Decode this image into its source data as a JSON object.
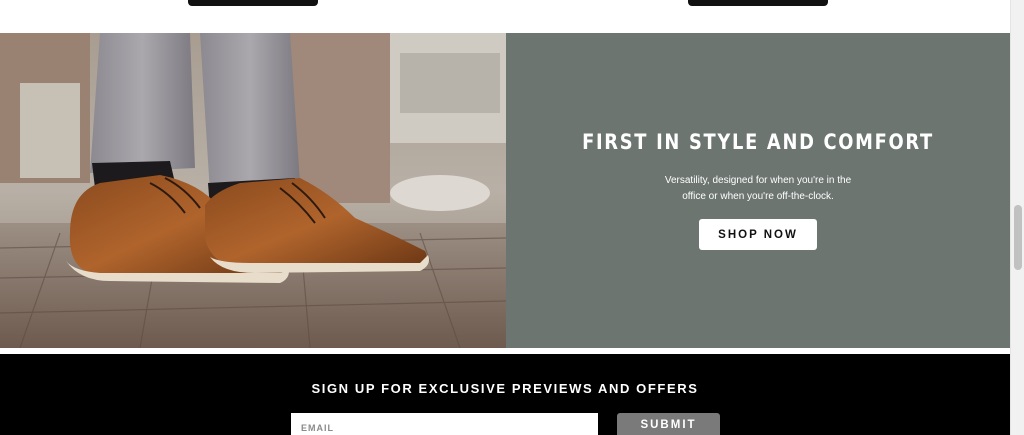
{
  "hero": {
    "title": "FIRST IN STYLE AND COMFORT",
    "description_line1": "Versatility, designed for when you're in the",
    "description_line2": "office or when you're off-the-clock.",
    "cta_label": "SHOP NOW",
    "panel_color": "#6c7570"
  },
  "newsletter": {
    "heading": "SIGN UP FOR EXCLUSIVE PREVIEWS AND OFFERS",
    "email_placeholder": "EMAIL",
    "submit_label": "SUBMIT",
    "background": "#000000",
    "submit_color": "#7a7a7a"
  },
  "icons": {
    "hero_image": "brown-leather-shoes-photo"
  }
}
